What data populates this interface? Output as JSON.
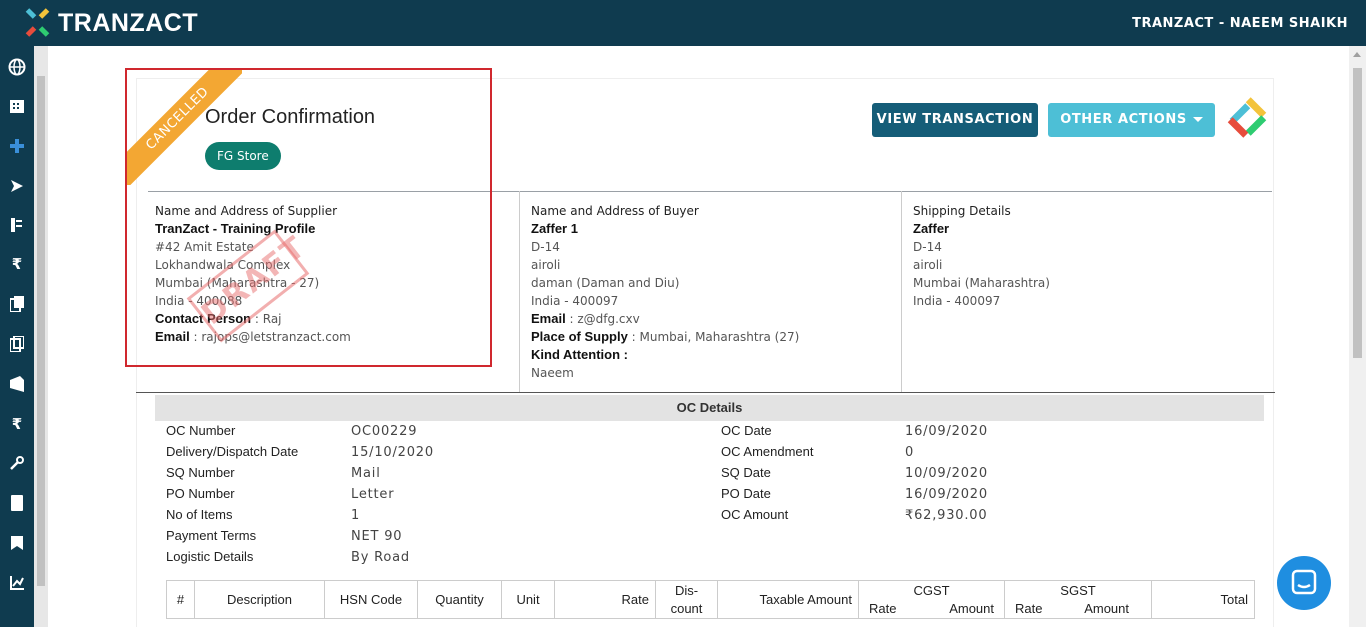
{
  "topbar": {
    "brand": "TRANZACT",
    "user": "TRANZACT - NAEEM SHAIKH"
  },
  "sidebar": {
    "icons": [
      "globe-icon",
      "building-icon",
      "plus-nodes-icon",
      "send-icon",
      "list-icon",
      "rupee-icon",
      "copy-icon",
      "document-copy-icon",
      "funnel-icon",
      "rupee-list-icon",
      "wrench-icon",
      "book-icon",
      "bookmark-icon",
      "chart-icon"
    ]
  },
  "header": {
    "ribbon": "CANCELLED",
    "title": "Order Confirmation",
    "store": "FG Store",
    "view_button": "VIEW TRANSACTION",
    "other_button": "OTHER ACTIONS"
  },
  "supplier": {
    "heading": "Name and Address of Supplier",
    "name": "TranZact - Training Profile",
    "line1": "#42 Amit Estate",
    "line2": "Lokhandwala Complex",
    "line3": "Mumbai (Maharashtra - 27)",
    "line4": "India - 400088",
    "contact_label": "Contact Person",
    "contact_value": " : Raj",
    "email_label": "Email",
    "email_value": " : rajops@letstranzact.com",
    "stamp": "DRAFT"
  },
  "buyer": {
    "heading": "Name and Address of Buyer",
    "name": "Zaffer 1",
    "line1": "D-14",
    "line2": "airoli",
    "line3": "daman (Daman and Diu)",
    "line4": "India - 400097",
    "email_label": "Email",
    "email_value": " : z@dfg.cxv",
    "supply_label": "Place of Supply",
    "supply_value": " : Mumbai, Maharashtra (27)",
    "attention_label": "Kind Attention :",
    "attention_value": "Naeem"
  },
  "shipping": {
    "heading": "Shipping Details",
    "name": "Zaffer",
    "line1": "D-14",
    "line2": "airoli",
    "line3": "Mumbai (Maharashtra)",
    "line4": "India - 400097"
  },
  "oc_details": {
    "title": "OC Details",
    "left": [
      {
        "label": "OC Number",
        "value": "OC00229"
      },
      {
        "label": "Delivery/Dispatch Date",
        "value": "15/10/2020"
      },
      {
        "label": "SQ Number",
        "value": "Mail"
      },
      {
        "label": "PO Number",
        "value": "Letter"
      },
      {
        "label": "No of Items",
        "value": "1"
      },
      {
        "label": "Payment Terms",
        "value": "NET 90"
      },
      {
        "label": "Logistic Details",
        "value": "By Road"
      }
    ],
    "right": [
      {
        "label": "OC Date",
        "value": "16/09/2020"
      },
      {
        "label": "OC Amendment",
        "value": "0"
      },
      {
        "label": "SQ Date",
        "value": "10/09/2020"
      },
      {
        "label": "PO Date",
        "value": "16/09/2020"
      },
      {
        "label": "OC Amount",
        "value": "₹62,930.00"
      }
    ]
  },
  "table": {
    "headers": {
      "num": "#",
      "description": "Description",
      "hsn": "HSN Code",
      "quantity": "Quantity",
      "unit": "Unit",
      "rate": "Rate",
      "discount_1": "Dis-",
      "discount_2": "count",
      "taxable": "Taxable Amount",
      "cgst": "CGST",
      "cgst_rate": "Rate",
      "cgst_amount": "Amount",
      "sgst": "SGST",
      "sgst_rate": "Rate",
      "sgst_amount": "Amount",
      "total": "Total"
    }
  },
  "colors": {
    "topbar": "#0f3b4f",
    "primary_button": "#155d78",
    "secondary_button": "#4dbfd6",
    "ribbon": "#f3a733",
    "badge": "#0e7d6e",
    "highlight": "#d0282e",
    "chat": "#1f8ee0"
  }
}
